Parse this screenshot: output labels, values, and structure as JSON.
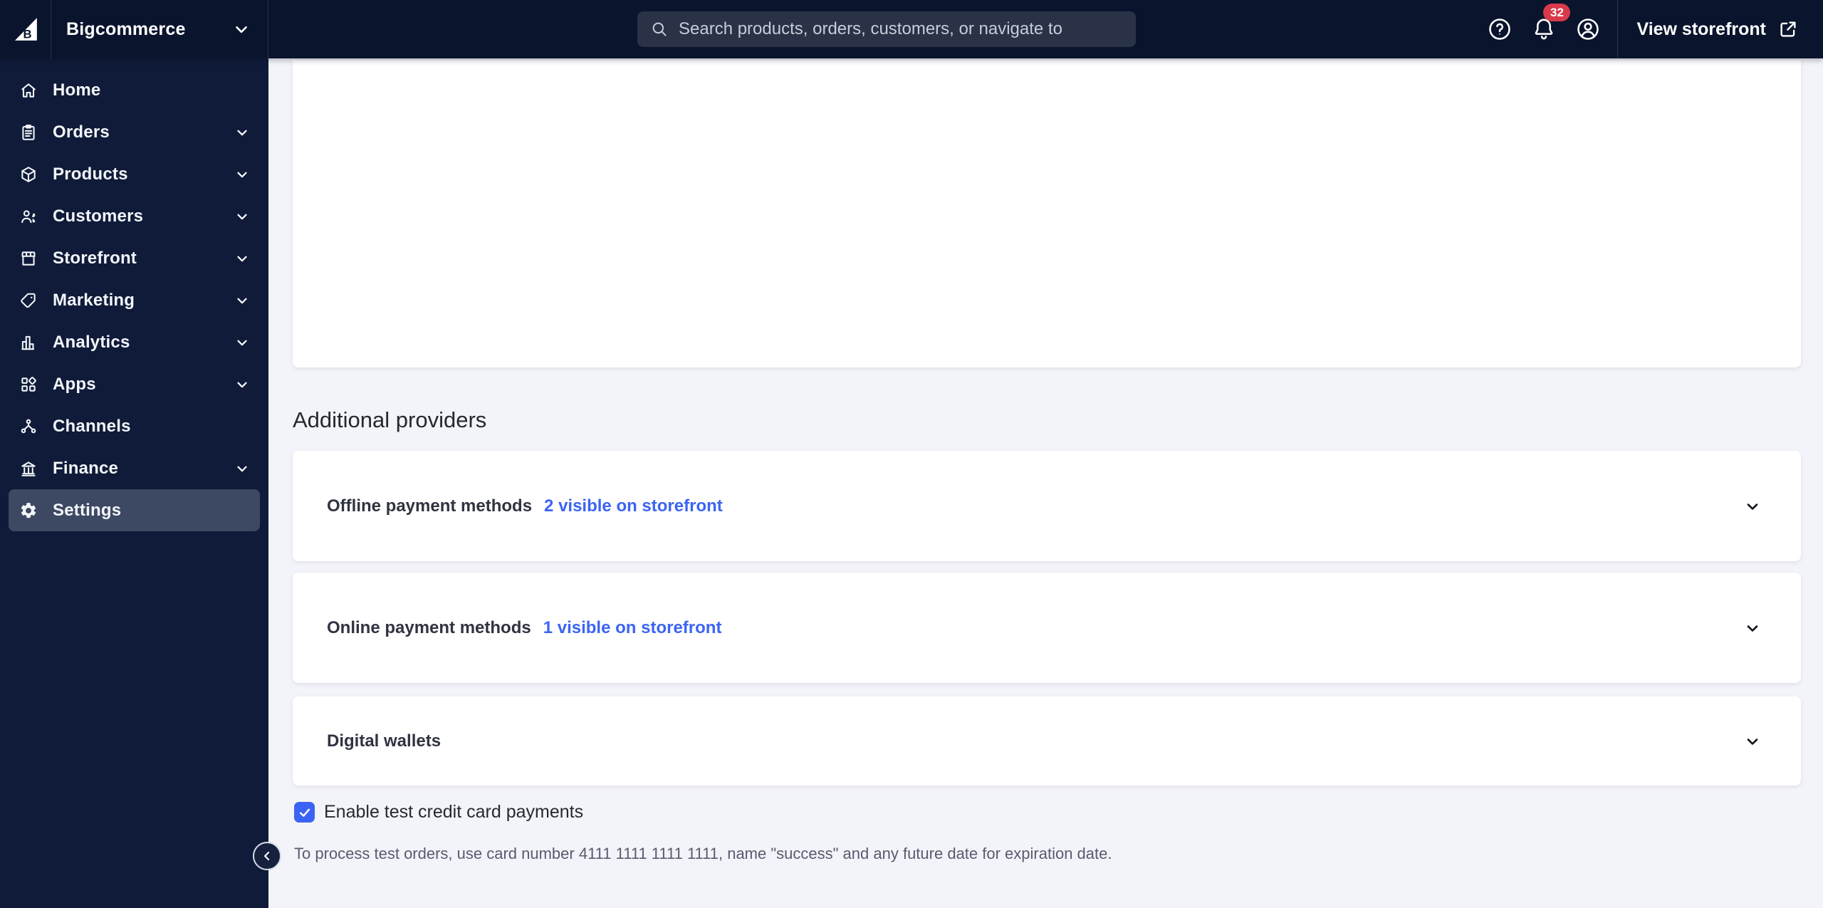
{
  "topbar": {
    "store_name": "Bigcommerce",
    "search_placeholder": "Search products, orders, customers, or navigate to",
    "notification_count": "32",
    "view_storefront_label": "View storefront",
    "icons": [
      "bigcommerce-logo",
      "chevron-down-icon",
      "search-icon",
      "help-icon",
      "bell-icon",
      "account-icon",
      "external-link-icon"
    ]
  },
  "sidebar": {
    "items": [
      {
        "label": "Home",
        "icon": "home-icon",
        "chevron": false,
        "active": false
      },
      {
        "label": "Orders",
        "icon": "orders-icon",
        "chevron": true,
        "active": false
      },
      {
        "label": "Products",
        "icon": "products-icon",
        "chevron": true,
        "active": false
      },
      {
        "label": "Customers",
        "icon": "customers-icon",
        "chevron": true,
        "active": false
      },
      {
        "label": "Storefront",
        "icon": "storefront-icon",
        "chevron": true,
        "active": false
      },
      {
        "label": "Marketing",
        "icon": "marketing-icon",
        "chevron": true,
        "active": false
      },
      {
        "label": "Analytics",
        "icon": "analytics-icon",
        "chevron": true,
        "active": false
      },
      {
        "label": "Apps",
        "icon": "apps-icon",
        "chevron": true,
        "active": false
      },
      {
        "label": "Channels",
        "icon": "channels-icon",
        "chevron": false,
        "active": false
      },
      {
        "label": "Finance",
        "icon": "finance-icon",
        "chevron": true,
        "active": false
      },
      {
        "label": "Settings",
        "icon": "settings-icon",
        "chevron": false,
        "active": true
      }
    ],
    "collapse_icon": "chevron-left-icon"
  },
  "main": {
    "section_heading": "Additional providers",
    "provider_cards": [
      {
        "title": "Offline payment methods",
        "link": "2 visible on storefront",
        "expand_icon": "chevron-down-icon"
      },
      {
        "title": "Online payment methods",
        "link": "1 visible on storefront",
        "expand_icon": "chevron-down-icon"
      },
      {
        "title": "Digital wallets",
        "link": "",
        "expand_icon": "chevron-down-icon"
      }
    ],
    "test_payments": {
      "checkbox_label": "Enable test credit card payments",
      "checked": true,
      "note": "To process test orders, use card number 4111 1111 1111 1111, name \"success\" and any future date for expiration date."
    }
  },
  "colors": {
    "topbar_bg": "#0a142d",
    "sidebar_bg": "#0f1b38",
    "active_item_bg": "#3d4962",
    "content_bg": "#f3f4f9",
    "accent_blue": "#3c64f4",
    "badge_red": "#d93a4a",
    "search_bg": "#293246"
  }
}
